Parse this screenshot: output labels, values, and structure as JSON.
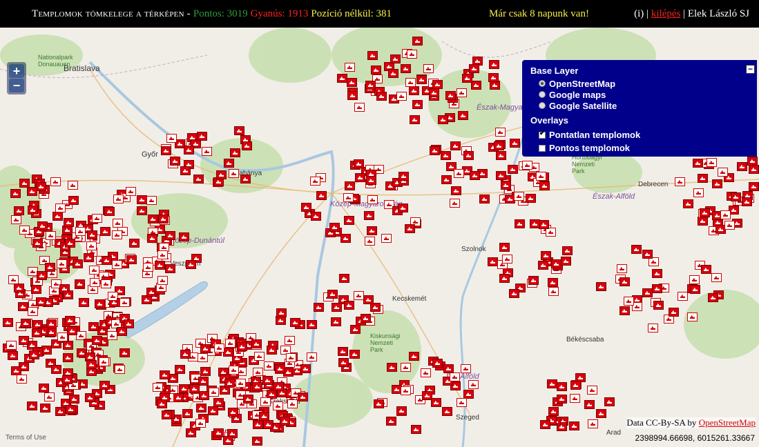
{
  "header": {
    "title": "Templomok tömkelege a térképen -",
    "pontos": "Pontos: 3019",
    "gyanus": "Gyanús: 1913",
    "pozicio": "Pozíció nélkül: 381",
    "motto": "Már csak 8 napunk van!",
    "info": "(i)",
    "separator1": "|",
    "logout": "kilépés",
    "separator2": "|",
    "user": "Elek László SJ"
  },
  "zoom": {
    "in": "+",
    "out": "−"
  },
  "layers": {
    "base_title": "Base Layer",
    "base": [
      {
        "label": "OpenStreetMap",
        "selected": true
      },
      {
        "label": "Google maps",
        "selected": false
      },
      {
        "label": "Google Satellite",
        "selected": false
      }
    ],
    "overlays_title": "Overlays",
    "overlays": [
      {
        "label": "Pontatlan templomok",
        "checked": true
      },
      {
        "label": "Pontos templomok",
        "checked": false
      }
    ],
    "minimize": "−"
  },
  "places": {
    "bratislava": "Bratislava",
    "gyor": "Győr",
    "tatabanya": "Tatabánya",
    "veszprem": "Veszprém",
    "debrecen": "Debrecen",
    "szolnok": "Szolnok",
    "kecskemet": "Kecskemét",
    "bekescsaba": "Békéscsaba",
    "szekszard": "Szekszárd",
    "szeged": "Szeged",
    "arad": "Arad",
    "kozep_magyarorszag": "Közép-Magyarország",
    "kozep_dunantul": "Közép-Dunántúl",
    "eszak_alfold": "Észak-Alföld",
    "eszak_magyarorszag": "Észak-Magyarország",
    "del_alfold": "Dél-Alföld",
    "park_dunaauen": "Nationalpark\nDonauauen",
    "park_hortobagyi": "Hortobágyi\nNemzeti\nPark",
    "park_kiskunsagi": "Kiskunsági\nNemzeti\nPark"
  },
  "attribution": {
    "prefix": "Data CC-By-SA by",
    "link": "OpenStreetMap"
  },
  "coordinates": "2398994.66698, 6015261.33667",
  "terms": "Terms of Use",
  "colors": {
    "marker_red": "#d8000c",
    "layer_panel": "#00008b",
    "topbar": "#000000"
  }
}
